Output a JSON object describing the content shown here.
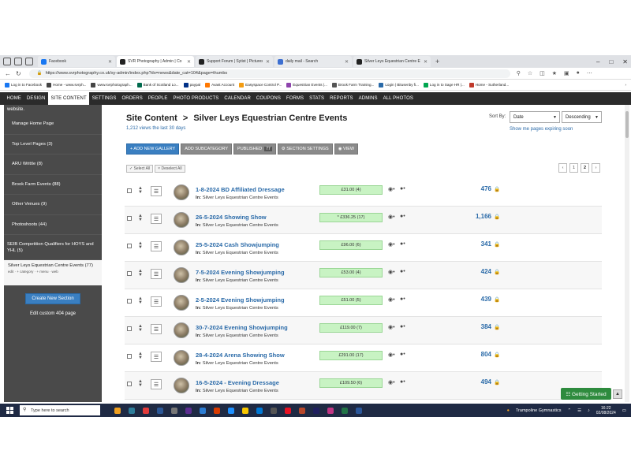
{
  "browser": {
    "tabs": [
      {
        "label": "Facebook",
        "color": "#1877f2",
        "active": false
      },
      {
        "label": "SVR Photography | Admin | Co",
        "color": "#222222",
        "active": true
      },
      {
        "label": "Support Forum | Sytist | Pictures",
        "color": "#222222",
        "active": false
      },
      {
        "label": "daily mail - Search",
        "color": "#3d6fd1",
        "active": false
      },
      {
        "label": "Silver Leys Equestrian Centre Ev",
        "color": "#222222",
        "active": false
      }
    ],
    "url": "https://www.svrphotography.co.uk/sy-admin/index.php?do=news&date_cat=104&page=thumbs",
    "bookmarks": [
      {
        "label": "Log in to Facebook",
        "color": "#1877f2"
      },
      {
        "label": "Home - www.svrph...",
        "color": "#444444"
      },
      {
        "label": "www.svrphotograph...",
        "color": "#444444"
      },
      {
        "label": "Bank of Scotland Lo...",
        "color": "#006a4d"
      },
      {
        "label": "paypal",
        "color": "#003087"
      },
      {
        "label": "Avast Account",
        "color": "#ff7800"
      },
      {
        "label": "Easyspace Control P...",
        "color": "#f39c12"
      },
      {
        "label": "Equestrian Events |...",
        "color": "#8e44ad"
      },
      {
        "label": "Brook Farm Training...",
        "color": "#555555"
      },
      {
        "label": "Login | Bitusenby fi...",
        "color": "#2a6aa8"
      },
      {
        "label": "Log in to Sage HR |...",
        "color": "#00a650"
      },
      {
        "label": "Home - Sutherland...",
        "color": "#c0392b"
      }
    ]
  },
  "nav": {
    "items": [
      "HOME",
      "DESIGN",
      "SITE CONTENT",
      "SETTINGS",
      "ORDERS",
      "PEOPLE",
      "PHOTO PRODUCTS",
      "CALENDAR",
      "COUPONS",
      "FORMS",
      "STATS",
      "REPORTS",
      "ADMINS",
      "ALL PHOTOS"
    ],
    "active": "SITE CONTENT"
  },
  "sidebar": {
    "top_text": "website.",
    "items": [
      "Manage Home Page",
      "Top Level Pages (3)",
      "ARU Writtle (8)",
      "Brook Farm Events (88)",
      "Other Venues (9)",
      "Photoshoots (44)",
      "SEIB Competition Qualifiers for HOYS and YHL (5)"
    ],
    "active_item": "Silver Leys Equestrian Centre Events (77)",
    "active_links": "edit  · + category  · + menu  · web",
    "create_button": "Create New Section",
    "custom_404": "Edit custom 404 page"
  },
  "header": {
    "breadcrumb_root": "Site Content",
    "breadcrumb_sep": ">",
    "breadcrumb_current": "Silver Leys Equestrian Centre Events",
    "views": "1,212 views the last 30 days",
    "sort_label": "Sort By:",
    "sort_field": "Date",
    "sort_order": "Descending",
    "expiring_link": "Show me pages expiring soon"
  },
  "toolbar": {
    "add_gallery": "+ ADD NEW GALLERY",
    "add_subcategory": "ADD SUBCATEGORY",
    "published": "PUBLISHED",
    "published_count": "77",
    "section_settings": "⚙ SECTION SETTINGS",
    "view": "◉ VIEW",
    "select_all": "✓ Select All",
    "deselect_all": "× Deselect All"
  },
  "pager": {
    "prev": "‹",
    "p1": "1",
    "p2": "2",
    "next": "›"
  },
  "rows": [
    {
      "name": "1-8-2024 BD Affiliated Dressage",
      "in_label": "In:",
      "in_value": "Silver Leys Equestrian Centre Events",
      "price": "£31.00 (4)",
      "count": "476"
    },
    {
      "name": "26-5-2024 Showing Show",
      "in_label": "In:",
      "in_value": "Silver Leys Equestrian Centre Events",
      "price": "* £336.25 (17)",
      "count": "1,166"
    },
    {
      "name": "25-5-2024 Cash Showjumping",
      "in_label": "In:",
      "in_value": "Silver Leys Equestrian Centre Events",
      "price": "£96.00 (6)",
      "count": "341"
    },
    {
      "name": "7-5-2024 Evening Showjumping",
      "in_label": "In:",
      "in_value": "Silver Leys Equestrian Centre Events",
      "price": "£53.00 (4)",
      "count": "424"
    },
    {
      "name": "2-5-2024 Evening Showjumping",
      "in_label": "In:",
      "in_value": "Silver Leys Equestrian Centre Events",
      "price": "£51.00 (5)",
      "count": "439"
    },
    {
      "name": "30-7-2024 Evening Showjumping",
      "in_label": "In:",
      "in_value": "Silver Leys Equestrian Centre Events",
      "price": "£119.00 (7)",
      "count": "384"
    },
    {
      "name": "28-4-2024 Arena Showing Show",
      "in_label": "In:",
      "in_value": "Silver Leys Equestrian Centre Events",
      "price": "£291.00 (17)",
      "count": "804"
    },
    {
      "name": "16-5-2024 - Evening Dressage",
      "in_label": "In:",
      "in_value": "Silver Leys Equestrian Centre Events",
      "price": "£109.50 (6)",
      "count": "494"
    }
  ],
  "getting_started": "☷ Getting Started",
  "taskbar": {
    "search_placeholder": "Type here to search",
    "weather": "Trampoline Gymnastics",
    "time": "16:22",
    "date": "02/08/2024",
    "apps": [
      "#f0a020",
      "#2d7d9a",
      "#e23b3b",
      "#2b5797",
      "#777777",
      "#5c2d91",
      "#2b7cd3",
      "#d83b01",
      "#1e90ff",
      "#f7c600",
      "#0078d4",
      "#555555",
      "#e81123",
      "#b7472a",
      "#1f1f5f",
      "#c13584",
      "#217346",
      "#2b579a"
    ]
  }
}
